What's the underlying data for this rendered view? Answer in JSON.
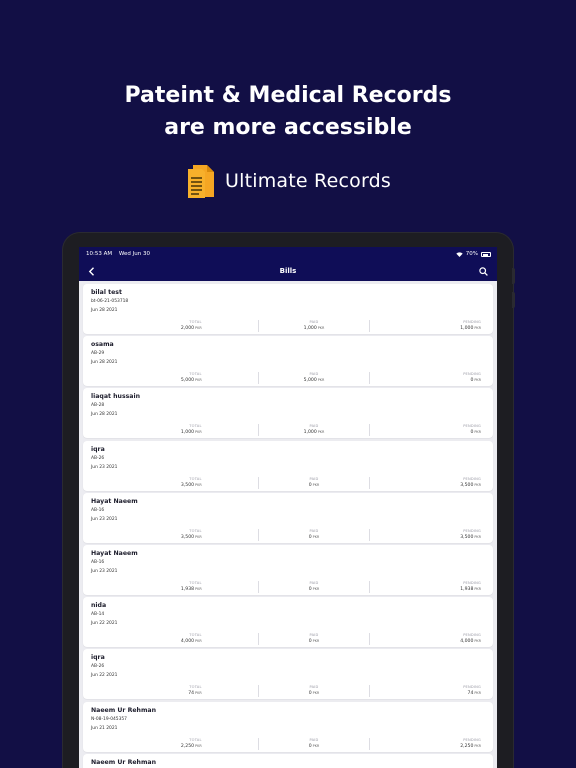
{
  "hero": {
    "headline_line1": "Pateint & Medical Records",
    "headline_line2": "are more accessible",
    "brand_name": "Ultimate Records",
    "brand_icon": "document-icon",
    "brand_icon_color": "#f5a623"
  },
  "status_bar": {
    "time": "10:53 AM",
    "date": "Wed Jun 30",
    "battery": "70%"
  },
  "nav": {
    "title": "Bills",
    "back_icon": "chevron-left-icon",
    "search_icon": "search-icon"
  },
  "labels": {
    "total": "TOTAL",
    "paid": "PAID",
    "pending": "PENDING",
    "currency": "PKR"
  },
  "bills": [
    {
      "name": "bilal test",
      "id": "bt-06-21-053718",
      "date": "Jun 28 2021",
      "total": "2,000",
      "paid": "1,000",
      "pending": "1,000"
    },
    {
      "name": "osama",
      "id": "AB-29",
      "date": "Jun 28 2021",
      "total": "5,000",
      "paid": "5,000",
      "pending": "0"
    },
    {
      "name": "liaqat hussain",
      "id": "AB-28",
      "date": "Jun 28 2021",
      "total": "1,000",
      "paid": "1,000",
      "pending": "0"
    },
    {
      "name": "iqra",
      "id": "AB-26",
      "date": "Jun 23 2021",
      "total": "3,500",
      "paid": "0",
      "pending": "3,500"
    },
    {
      "name": "Hayat Naeem",
      "id": "AB-16",
      "date": "Jun 23 2021",
      "total": "3,500",
      "paid": "0",
      "pending": "3,500"
    },
    {
      "name": "Hayat Naeem",
      "id": "AB-16",
      "date": "Jun 23 2021",
      "total": "1,938",
      "paid": "0",
      "pending": "1,938"
    },
    {
      "name": "nida",
      "id": "AB-14",
      "date": "Jun 22 2021",
      "total": "4,000",
      "paid": "0",
      "pending": "4,000"
    },
    {
      "name": "iqra",
      "id": "AB-26",
      "date": "Jun 22 2021",
      "total": "74",
      "paid": "0",
      "pending": "74"
    },
    {
      "name": "Naeem Ur Rehman",
      "id": "N-08-19-045357",
      "date": "Jun 21 2021",
      "total": "2,250",
      "paid": "0",
      "pending": "2,250"
    },
    {
      "name": "Naeem Ur Rehman",
      "id": "",
      "date": "",
      "total": "",
      "paid": "",
      "pending": ""
    }
  ],
  "colors": {
    "page_background": "#120f45",
    "app_bar": "#0f0d57",
    "list_background": "#ececf1",
    "card": "#ffffff"
  }
}
